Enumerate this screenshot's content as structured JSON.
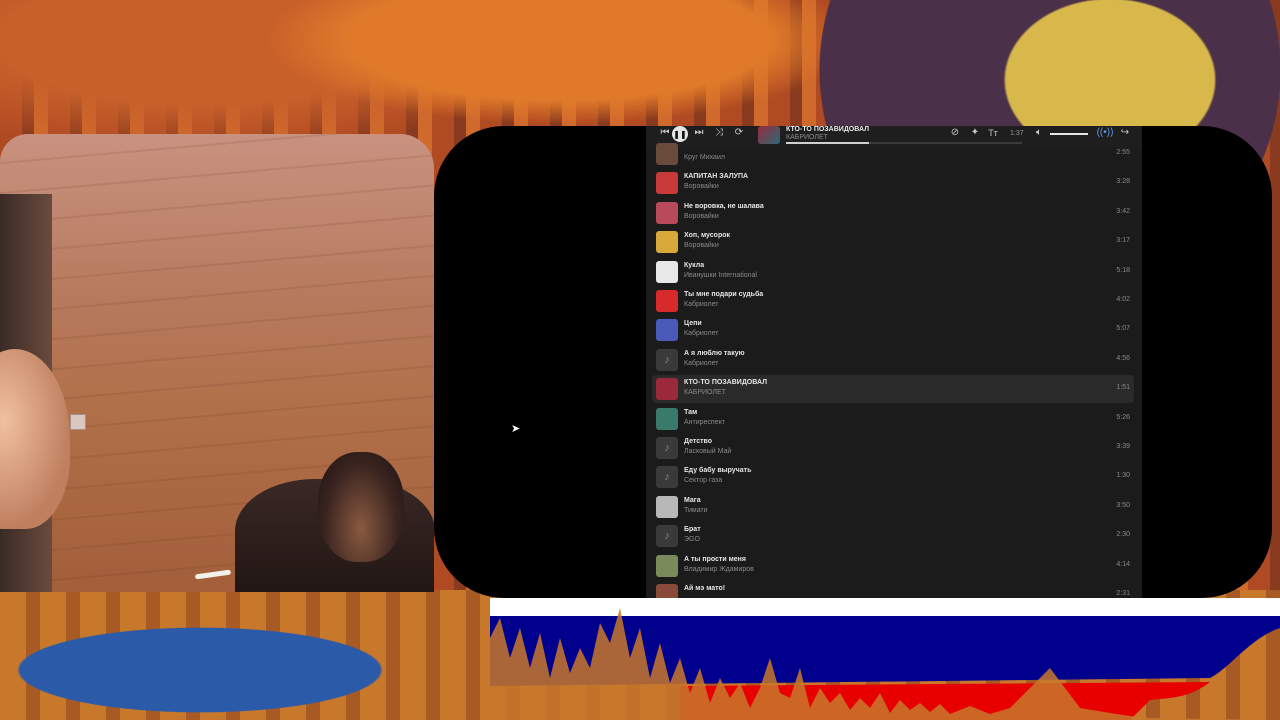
{
  "player": {
    "now_playing_title": "КТО-ТО ПОЗАВИДОВАЛ",
    "now_playing_artist": "КАБРИОЛЕТ",
    "elapsed": "1:37",
    "progress_fraction": 0.35,
    "volume_fraction": 1.0
  },
  "tracks": [
    {
      "title": "",
      "artist": "Круг Михаил",
      "duration": "2:55",
      "cover": "#6a4a3a"
    },
    {
      "title": "КАПИТАН ЗАЛУПА",
      "artist": "Воровайки",
      "duration": "3:28",
      "cover": "#c83a3a"
    },
    {
      "title": "Не воровка, не шалава",
      "artist": "Воровайки",
      "duration": "3:42",
      "cover": "#b84a5a"
    },
    {
      "title": "Хоп, мусорок",
      "artist": "Воровайки",
      "duration": "3:17",
      "cover": "#d8a83a"
    },
    {
      "title": "Кукла",
      "artist": "Иванушки International",
      "duration": "5:18",
      "cover": "#e8e8e8"
    },
    {
      "title": "Ты мне подари судьба",
      "artist": "Кабриолет",
      "duration": "4:02",
      "cover": "#d82a2a"
    },
    {
      "title": "Цепи",
      "artist": "Кабриолет",
      "duration": "5:07",
      "cover": "#4a5ab8"
    },
    {
      "title": "А я люблю такую",
      "artist": "Кабриолет",
      "duration": "4:56",
      "cover": ""
    },
    {
      "title": "КТО-ТО ПОЗАВИДОВАЛ",
      "artist": "КАБРИОЛЕТ",
      "duration": "1:51",
      "cover": "#9a2a3a",
      "active": true
    },
    {
      "title": "Там",
      "artist": "Антиреспект",
      "duration": "5:26",
      "cover": "#3a7a6a"
    },
    {
      "title": "Детство",
      "artist": "Ласковый Май",
      "duration": "3:39",
      "cover": ""
    },
    {
      "title": "Еду бабу выручать",
      "artist": "Сектор газа",
      "duration": "1:30",
      "cover": ""
    },
    {
      "title": "Мага",
      "artist": "Тимати",
      "duration": "3:50",
      "cover": "#b8b8b8"
    },
    {
      "title": "Брат",
      "artist": "ЭGO",
      "duration": "2:30",
      "cover": ""
    },
    {
      "title": "А ты прости меня",
      "artist": "Владимир Ждамиров",
      "duration": "4:14",
      "cover": "#7a8a5a"
    },
    {
      "title": "Ай мэ мато!",
      "artist": "",
      "duration": "2:31",
      "cover": "#8a4a3a"
    }
  ],
  "icons": {
    "prev": "prev-icon",
    "pause": "pause-icon",
    "next": "next-icon",
    "shuffle": "shuffle-icon",
    "repeat": "repeat-icon",
    "dislike": "dislike-icon",
    "sparkle": "sparkle-icon",
    "text": "text-icon",
    "volume": "volume-icon",
    "broadcast": "broadcast-icon",
    "share": "share-icon",
    "note": "music-note-icon"
  },
  "colors": {
    "panel": "#1b1b1b",
    "active_row": "#2a2a2a",
    "flag_white": "#ffffff",
    "flag_blue": "#00008c",
    "flag_red": "#e80000"
  }
}
